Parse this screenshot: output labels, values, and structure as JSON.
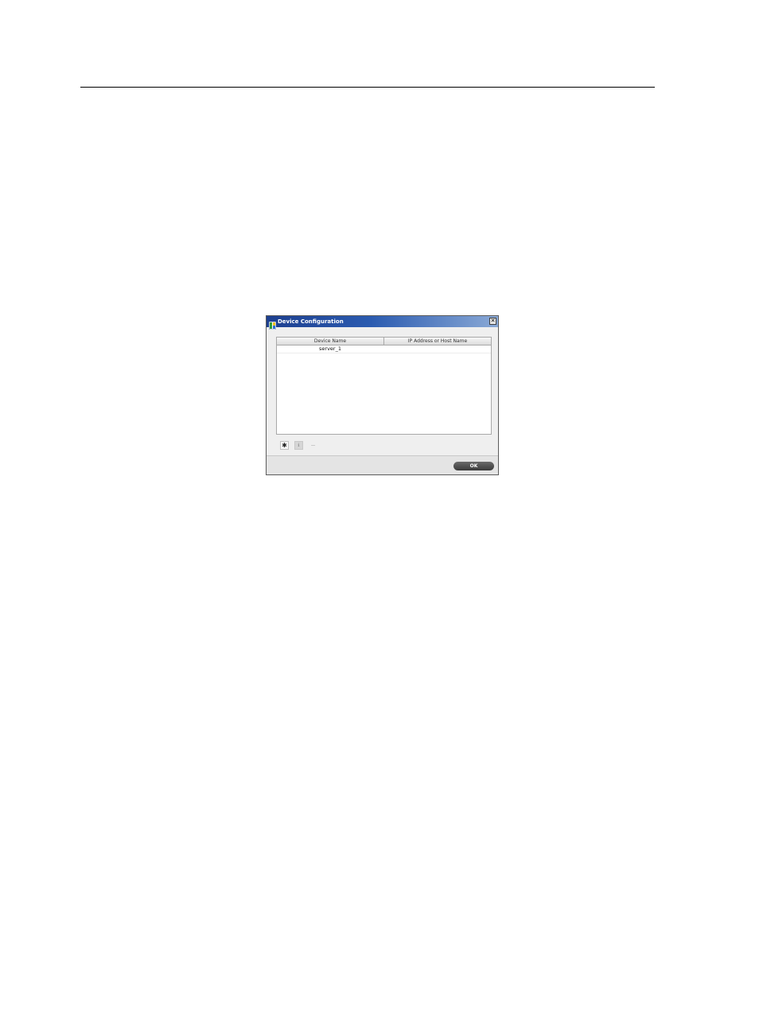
{
  "dialog": {
    "title": "Device Configuration",
    "close_glyph": "✕",
    "app_icon": "device-config-app-icon"
  },
  "table": {
    "columns": [
      "Device Name",
      "IP Address or Host Name"
    ],
    "rows": [
      {
        "device_name": "server_1",
        "address": ""
      }
    ]
  },
  "toolbar": {
    "add_glyph": "✱",
    "edit_glyph": "ℹ",
    "remove_glyph": "−",
    "add_icon": "add-icon",
    "edit_icon": "info-icon",
    "remove_icon": "minus-icon"
  },
  "footer": {
    "ok_label": "OK"
  }
}
